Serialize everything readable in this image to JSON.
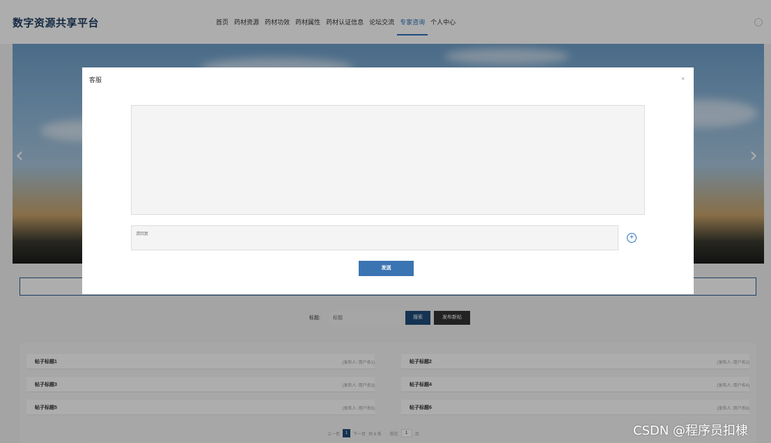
{
  "header": {
    "logo": "数字资源共享平台",
    "nav": [
      {
        "label": "首页"
      },
      {
        "label": "药材资源"
      },
      {
        "label": "药材功效"
      },
      {
        "label": "药材属性"
      },
      {
        "label": "药材认证信息"
      },
      {
        "label": "论坛交流"
      },
      {
        "label": "专家咨询"
      },
      {
        "label": "个人中心"
      }
    ],
    "active_nav": "专家咨询"
  },
  "banner": {
    "prev_arrow": "‹",
    "next_arrow": "›"
  },
  "search": {
    "label": "标题:",
    "placeholder": "标题",
    "search_button": "搜索",
    "post_button": "发布新帖"
  },
  "posts": [
    {
      "title": "帖子标题1",
      "author": "(发布人: 用户名1)"
    },
    {
      "title": "帖子标题2",
      "author": "(发布人: 用户名2)"
    },
    {
      "title": "帖子标题3",
      "author": "(发布人: 用户名3)"
    },
    {
      "title": "帖子标题4",
      "author": "(发布人: 用户名4)"
    },
    {
      "title": "帖子标题5",
      "author": "(发布人: 用户名5)"
    },
    {
      "title": "帖子标题6",
      "author": "(发布人: 用户名6)"
    }
  ],
  "pager": {
    "prev": "上一页",
    "current": "1",
    "next": "下一页",
    "total": "共 6 条",
    "goto": "前往",
    "page_input": "1",
    "page_unit": "页"
  },
  "modal": {
    "title": "客服",
    "close": "×",
    "reply_placeholder": "请回复",
    "plus": "+",
    "send_button": "发送"
  },
  "watermark": "CSDN @程序员扣棣",
  "colors": {
    "brand": "#1f4c7a",
    "accent": "#2c6fb6",
    "send": "#3b74b2"
  }
}
